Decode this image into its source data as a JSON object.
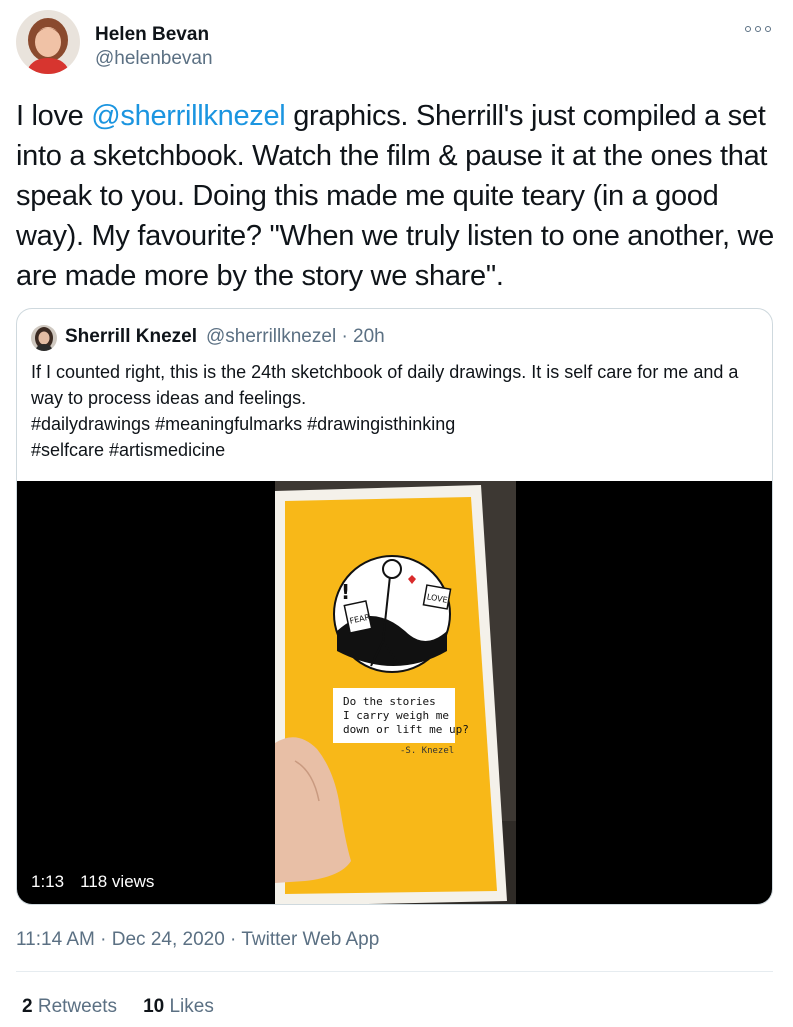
{
  "tweet": {
    "author_name": "Helen Bevan",
    "author_handle": "@helenbevan",
    "more_icon": "more-horizontal-icon",
    "text_before": "I love ",
    "mention": "@sherrillknezel",
    "text_after": " graphics. Sherrill's just compiled a set into a sketchbook. Watch the film & pause it at the ones that speak to you. Doing this made me quite teary (in a good way). My favourite? \"When we truly listen to one another, we are made more by the story we share\".",
    "timestamp": "11:14 AM · Dec 24, 2020",
    "source_sep": " · ",
    "source": "Twitter Web App",
    "retweets_count": "2",
    "retweets_label": "Retweets",
    "likes_count": "10",
    "likes_label": "Likes"
  },
  "quoted": {
    "author_name": "Sherrill Knezel",
    "author_handle": "@sherrillknezel · 20h",
    "text": "If I counted right, this is the 24th sketchbook of daily drawings. It is self care for me and a way to process ideas and feelings.\n#dailydrawings #meaningfulmarks #drawingisthinking\n#selfcare #artismedicine",
    "video": {
      "duration": "1:13",
      "views": "118 views",
      "sketch_caption_line1": "Do the stories",
      "sketch_caption_line2": "I carry weigh me",
      "sketch_caption_line3": "down or lift me up?",
      "sketch_signature": "-S. Knezel",
      "sketch_label_fear": "FEAR",
      "sketch_label_love": "LOVE"
    }
  },
  "colors": {
    "link": "#1b95e0",
    "secondary_text": "#5b7083",
    "sketchbook_yellow": "#f8b818"
  }
}
